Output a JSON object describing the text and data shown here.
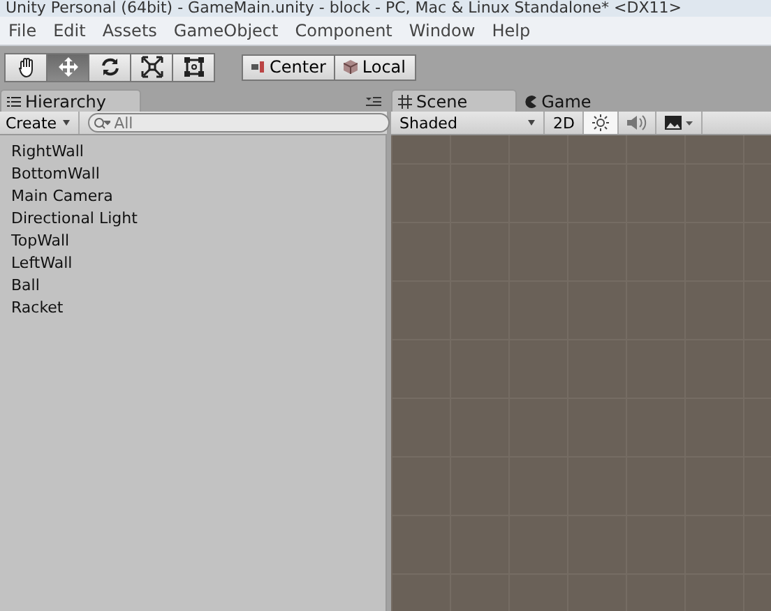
{
  "window": {
    "title": "Unity Personal (64bit) - GameMain.unity - block - PC, Mac & Linux Standalone* <DX11>"
  },
  "menu": [
    "File",
    "Edit",
    "Assets",
    "GameObject",
    "Component",
    "Window",
    "Help"
  ],
  "tools": [
    {
      "kind": "hand",
      "selected": false
    },
    {
      "kind": "move",
      "selected": true
    },
    {
      "kind": "rotate",
      "selected": false
    },
    {
      "kind": "scale",
      "selected": false
    },
    {
      "kind": "rect",
      "selected": false
    }
  ],
  "pivot_buttons": [
    {
      "kind": "center",
      "label": "Center"
    },
    {
      "kind": "local",
      "label": "Local"
    }
  ],
  "hierarchy": {
    "tab": "Hierarchy",
    "create": "Create",
    "search": {
      "placeholder": "All"
    },
    "items": [
      "RightWall",
      "BottomWall",
      "Main Camera",
      "Directional Light",
      "TopWall",
      "LeftWall",
      "Ball",
      "Racket"
    ]
  },
  "scene": {
    "tabs": [
      {
        "label": "Scene",
        "kind": "scene",
        "selected": true
      },
      {
        "label": "Game",
        "kind": "game",
        "selected": false
      }
    ],
    "shading": "Shaded",
    "mode_2d": {
      "label": "2D",
      "on": false
    },
    "lighting": {
      "on": true
    },
    "audio": {
      "on": false
    }
  }
}
